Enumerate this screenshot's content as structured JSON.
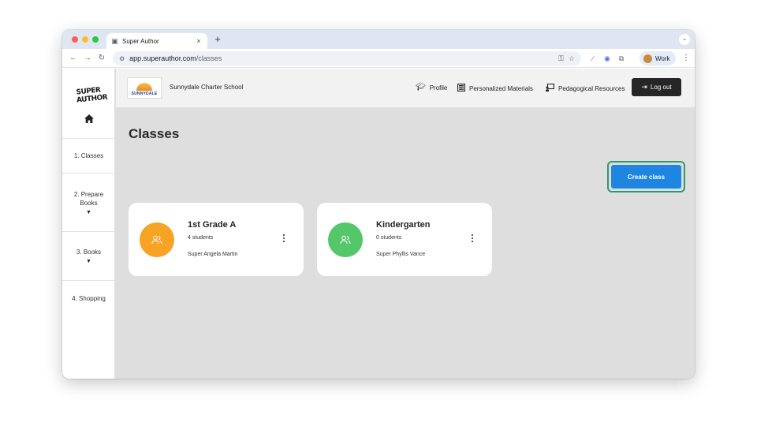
{
  "browser": {
    "tab_title": "Super Author",
    "tab_close": "×",
    "new_tab": "+",
    "url_host": "app.superauthor.com",
    "url_path": "/classes",
    "profile_label": "Work"
  },
  "sidebar": {
    "logo_line1": "SUPER",
    "logo_line2": "AUTHOR",
    "home_icon": "home-icon",
    "items": [
      {
        "label": "1. Classes",
        "has_caret": false
      },
      {
        "label": "2. Prepare Books",
        "has_caret": true
      },
      {
        "label": "3. Books",
        "has_caret": true
      },
      {
        "label": "4. Shopping",
        "has_caret": false
      }
    ]
  },
  "header": {
    "school_logo_text": "SUNNYDALE",
    "school_name": "Sunnydale Charter School",
    "nav": [
      {
        "icon": "graduation-cap-icon",
        "label": "Profile"
      },
      {
        "icon": "newspaper-icon",
        "label": "Personalized Materials"
      },
      {
        "icon": "chalkboard-teacher-icon",
        "label": "Pedagogical Resources"
      }
    ],
    "logout_label": "Log out"
  },
  "main": {
    "title": "Classes",
    "create_label": "Create class",
    "classes": [
      {
        "name": "1st Grade A",
        "students": "4 students",
        "teacher": "Super Angela Martin",
        "color": "#f7a325"
      },
      {
        "name": "Kindergarten",
        "students": "0 students",
        "teacher": "Super Phyllis Vance",
        "color": "#54c76b"
      }
    ]
  },
  "colors": {
    "accent_blue": "#1e86e0",
    "focus_ring": "#2e9b6c",
    "logout_bg": "#262626"
  }
}
